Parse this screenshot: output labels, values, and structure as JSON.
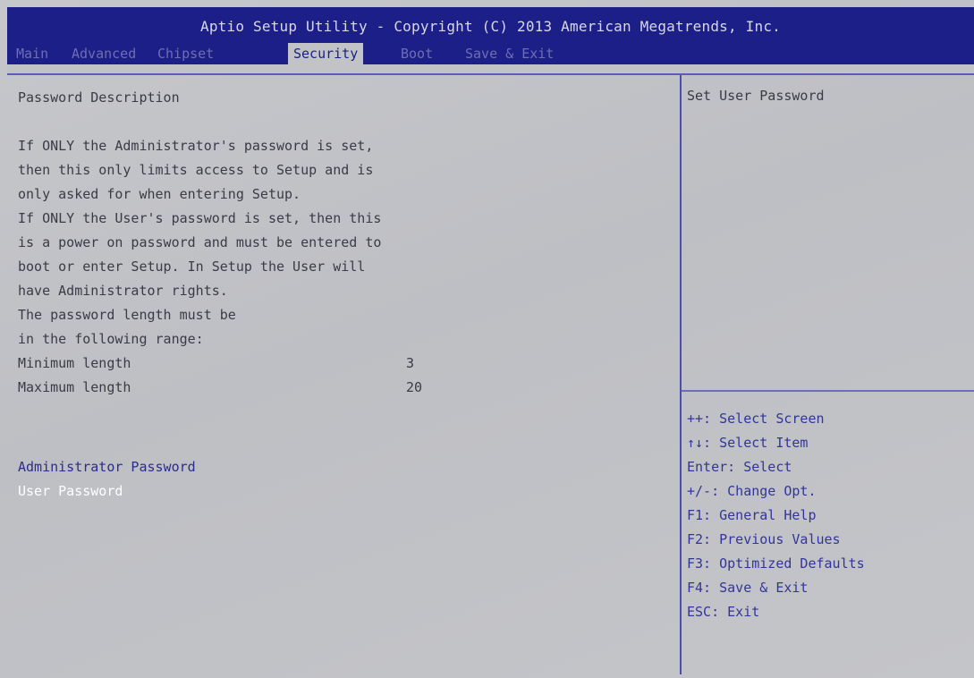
{
  "window": {
    "title": "Aptio Setup Utility - Copyright (C) 2013 American Megatrends, Inc."
  },
  "tabs": [
    {
      "label": "Main",
      "active": false
    },
    {
      "label": "Advanced",
      "active": false
    },
    {
      "label": "Chipset",
      "active": false
    },
    {
      "label": "Security",
      "active": true
    },
    {
      "label": "Boot",
      "active": false
    },
    {
      "label": "Save & Exit",
      "active": false
    }
  ],
  "main": {
    "heading": "Password Description",
    "description_lines": [
      "If ONLY the Administrator's password is set,",
      "then this only limits access to Setup and is",
      "only asked for when entering Setup.",
      "If ONLY the User's password is set, then this",
      "is a power on password and must be entered to",
      "boot or enter Setup. In Setup the User will",
      "have Administrator rights.",
      "The password length must be",
      "in the following range:"
    ],
    "min_label": "Minimum length",
    "min_value": "3",
    "max_label": "Maximum length",
    "max_value": "20",
    "menu_items": [
      {
        "label": "Administrator Password",
        "selected": false
      },
      {
        "label": "User Password",
        "selected": true
      }
    ]
  },
  "help": {
    "title": "Set User Password",
    "keys": [
      "++: Select Screen",
      "↑↓: Select Item",
      "Enter: Select",
      "+/-: Change Opt.",
      "F1: General Help",
      "F2: Previous Values",
      "F3: Optimized Defaults",
      "F4: Save & Exit",
      "ESC: Exit"
    ]
  },
  "colors": {
    "header_bg": "#1d1f88",
    "panel_bg": "#c2c3c7",
    "item_color": "#2a2c8f",
    "selected_color": "#ffffff",
    "text_color": "#3a3b46"
  }
}
